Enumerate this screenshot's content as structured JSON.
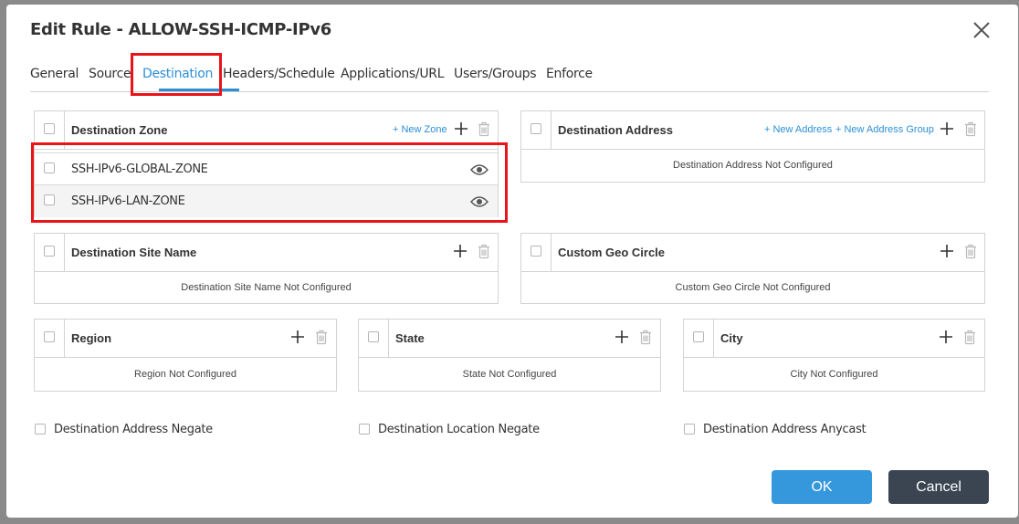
{
  "dialog": {
    "title": "Edit Rule - ALLOW-SSH-ICMP-IPv6"
  },
  "tabs": [
    {
      "label": "General"
    },
    {
      "label": "Source"
    },
    {
      "label": "Destination",
      "active": true
    },
    {
      "label": "Headers/Schedule"
    },
    {
      "label": "Applications/URL"
    },
    {
      "label": "Users/Groups"
    },
    {
      "label": "Enforce"
    }
  ],
  "destination_zone": {
    "header": "Destination Zone",
    "new_zone": "+ New Zone",
    "rows": [
      {
        "name": "SSH-IPv6-GLOBAL-ZONE"
      },
      {
        "name": "SSH-IPv6-LAN-ZONE"
      }
    ]
  },
  "destination_address": {
    "header": "Destination Address",
    "new_address": "+ New Address",
    "new_address_group": "+ New Address Group",
    "empty": "Destination Address Not Configured"
  },
  "destination_site_name": {
    "header": "Destination Site Name",
    "empty": "Destination Site Name Not Configured"
  },
  "custom_geo_circle": {
    "header": "Custom Geo Circle",
    "empty": "Custom Geo Circle Not Configured"
  },
  "region": {
    "header": "Region",
    "empty": "Region Not Configured"
  },
  "state": {
    "header": "State",
    "empty": "State Not Configured"
  },
  "city": {
    "header": "City",
    "empty": "City Not Configured"
  },
  "options": {
    "address_negate": "Destination Address Negate",
    "location_negate": "Destination Location Negate",
    "address_anycast": "Destination Address Anycast"
  },
  "buttons": {
    "ok": "OK",
    "cancel": "Cancel"
  },
  "colors": {
    "accent": "#2b8fd6",
    "highlight": "#e8141a",
    "ok": "#3597dc",
    "cancel": "#3b4552"
  },
  "icons": [
    "close-icon",
    "plus-icon",
    "trash-icon",
    "eye-icon"
  ]
}
